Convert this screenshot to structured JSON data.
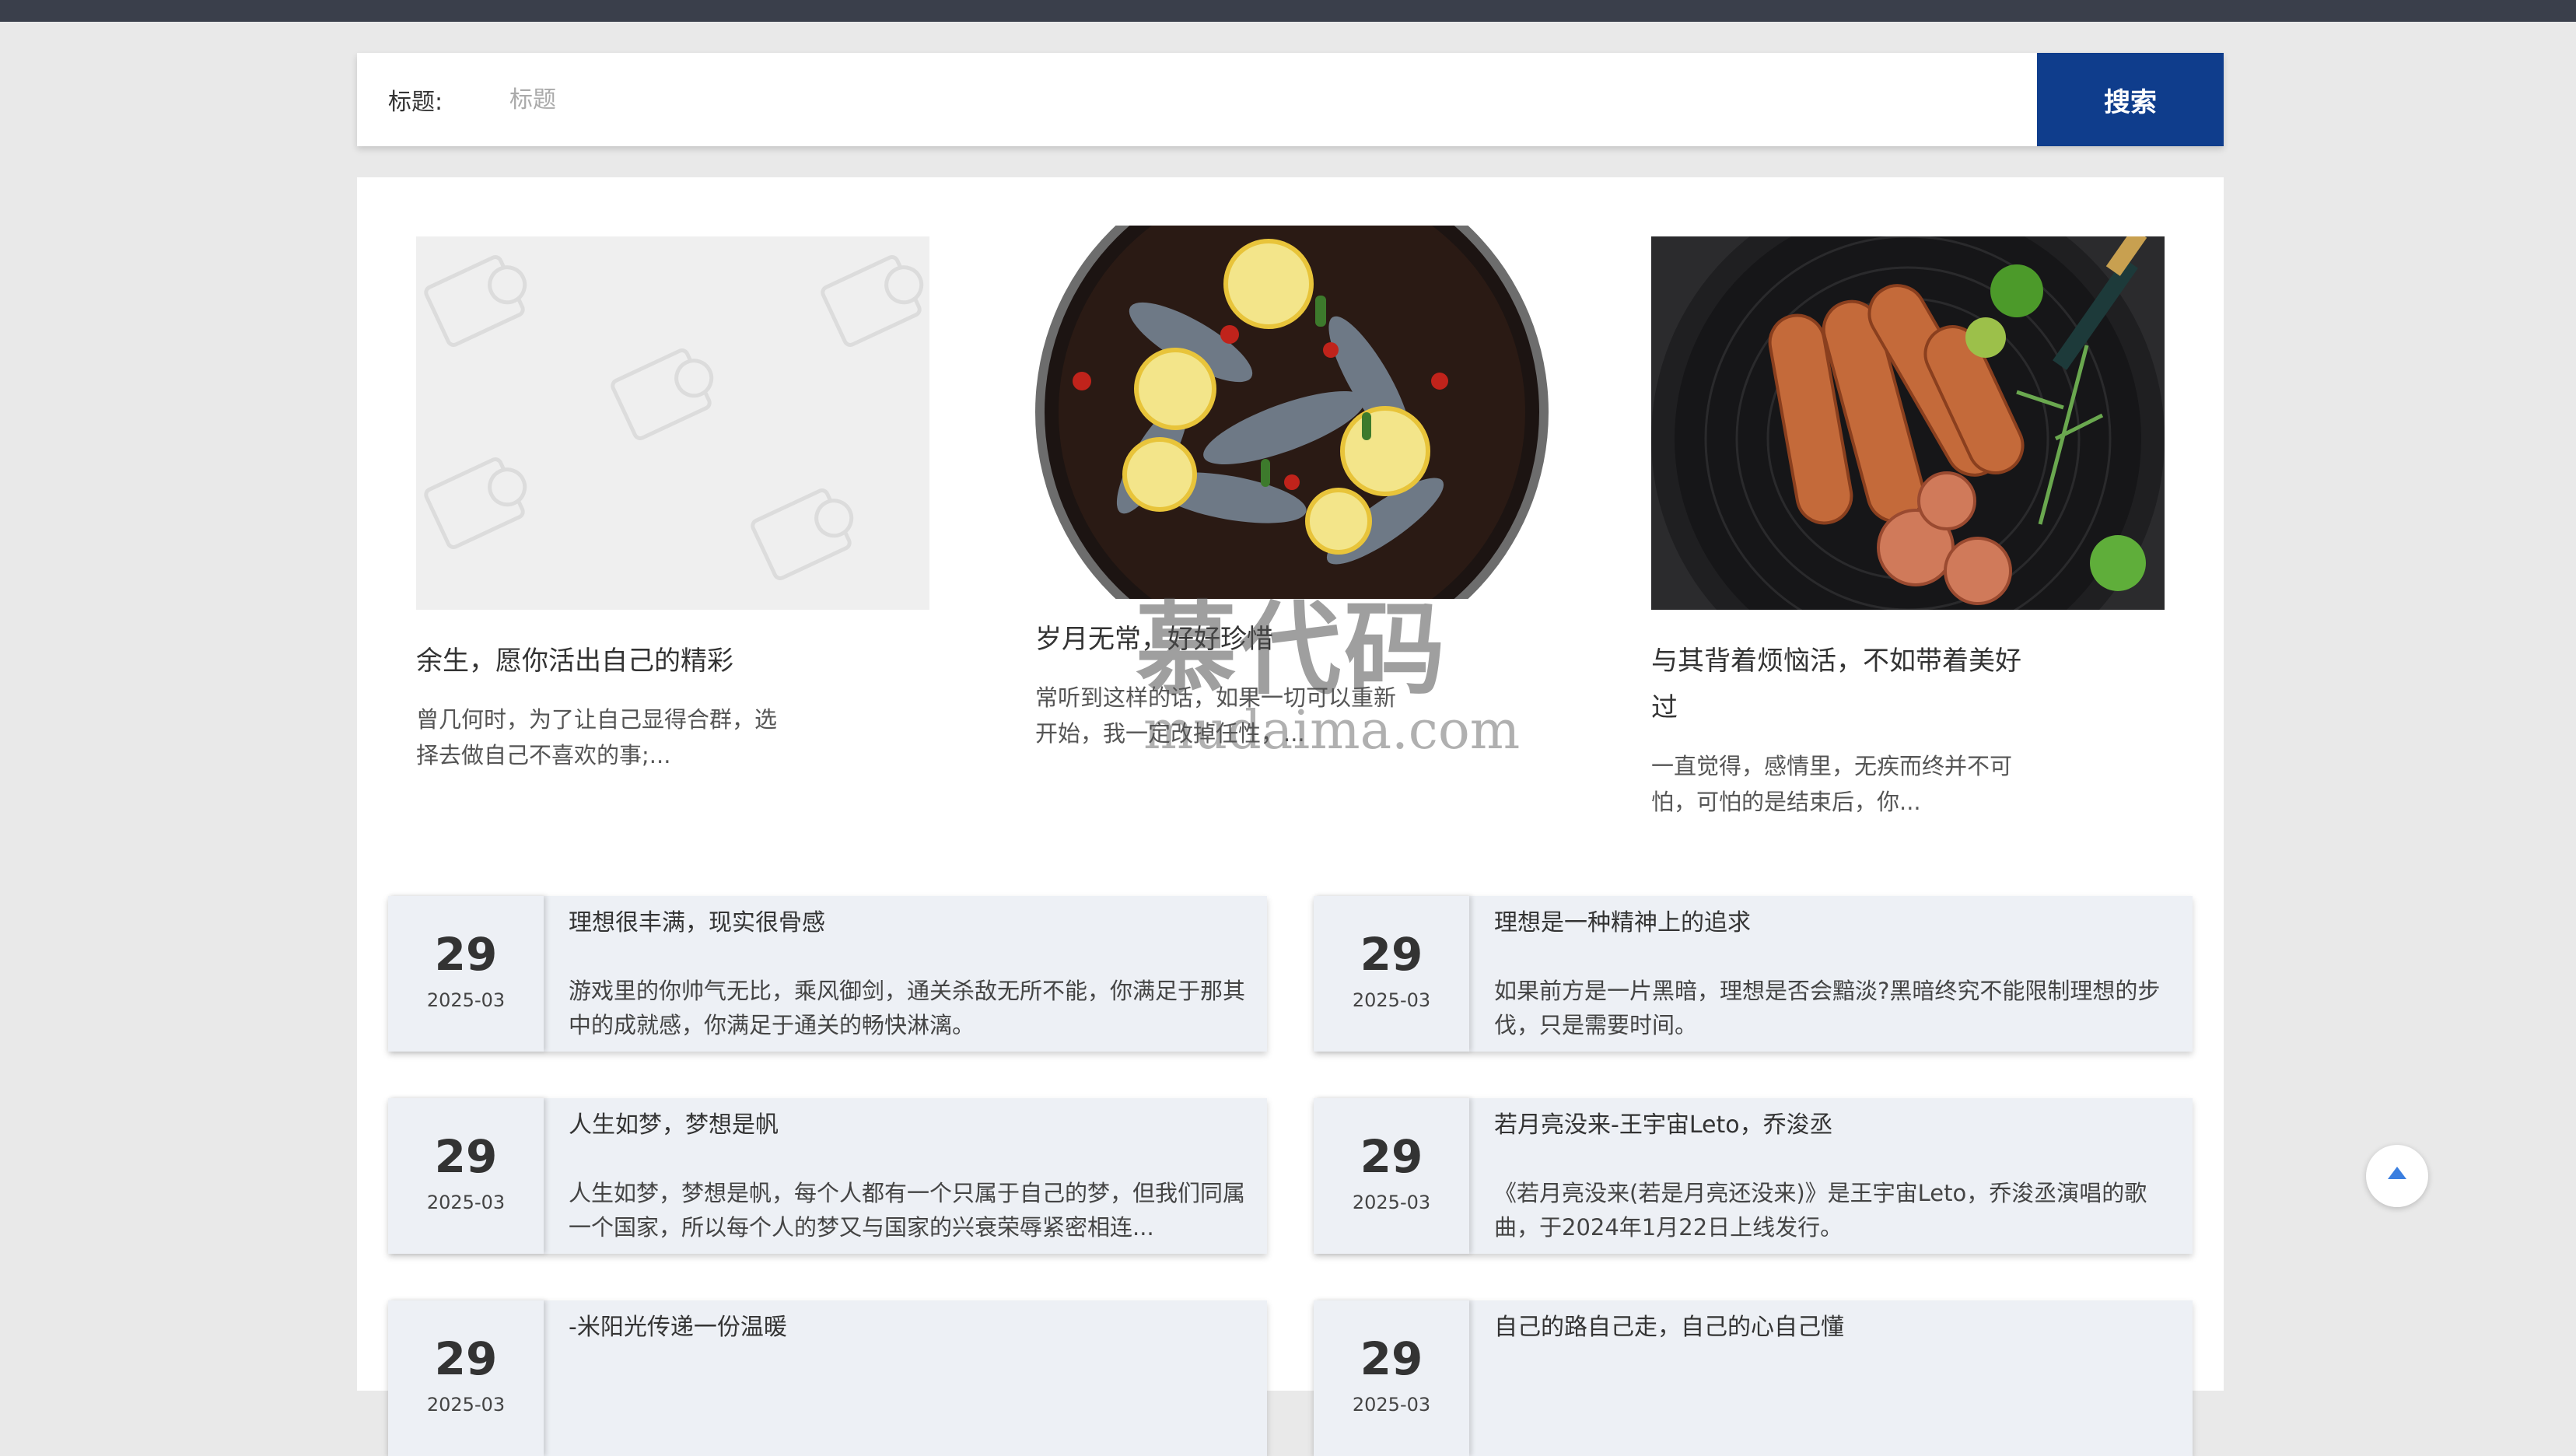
{
  "search": {
    "label": "标题:",
    "placeholder": "标题",
    "button_label": "搜索"
  },
  "featured": [
    {
      "image": "placeholder-image",
      "title": "余生，愿你活出自己的精彩",
      "desc": "曾几何时，为了让自己显得合群，选择去做自己不喜欢的事;..."
    },
    {
      "image": "shrimp-bowl-photo",
      "title": "岁月无常，好好珍惜",
      "desc": "常听到这样的话，如果一切可以重新开始，我一定改掉任性，..."
    },
    {
      "image": "sausage-plate-photo",
      "title": "与其背着烦恼活，不如带着美好过",
      "desc": "一直觉得，感情里，无疾而终并不可怕，可怕的是结束后，你..."
    }
  ],
  "news": [
    {
      "day": "29",
      "ym": "2025-03",
      "title": "理想很丰满，现实很骨感",
      "desc": "游戏里的你帅气无比，乘风御剑，通关杀敌无所不能，你满足于那其中的成就感，你满足于通关的畅快淋漓。"
    },
    {
      "day": "29",
      "ym": "2025-03",
      "title": "理想是一种精神上的追求",
      "desc": "如果前方是一片黑暗，理想是否会黯淡?黑暗终究不能限制理想的步伐，只是需要时间。"
    },
    {
      "day": "29",
      "ym": "2025-03",
      "title": "人生如梦，梦想是帆",
      "desc": "人生如梦，梦想是帆，每个人都有一个只属于自己的梦，但我们同属一个国家，所以每个人的梦又与国家的兴衰荣辱紧密相连..."
    },
    {
      "day": "29",
      "ym": "2025-03",
      "title": "若月亮没来-王宇宙Leto，乔浚丞",
      "desc": "《若月亮没来(若是月亮还没来)》是王宇宙Leto，乔浚丞演唱的歌曲，于2024年1月22日上线发行。"
    },
    {
      "day": "29",
      "ym": "2025-03",
      "title": "-米阳光传递一份温暖",
      "desc": ""
    },
    {
      "day": "29",
      "ym": "2025-03",
      "title": "自己的路自己走，自己的心自己懂",
      "desc": ""
    }
  ],
  "watermark": {
    "brand": "慕代码",
    "domain": "mudaima.com"
  },
  "icons": {
    "back_to_top": "arrow-up-icon"
  }
}
